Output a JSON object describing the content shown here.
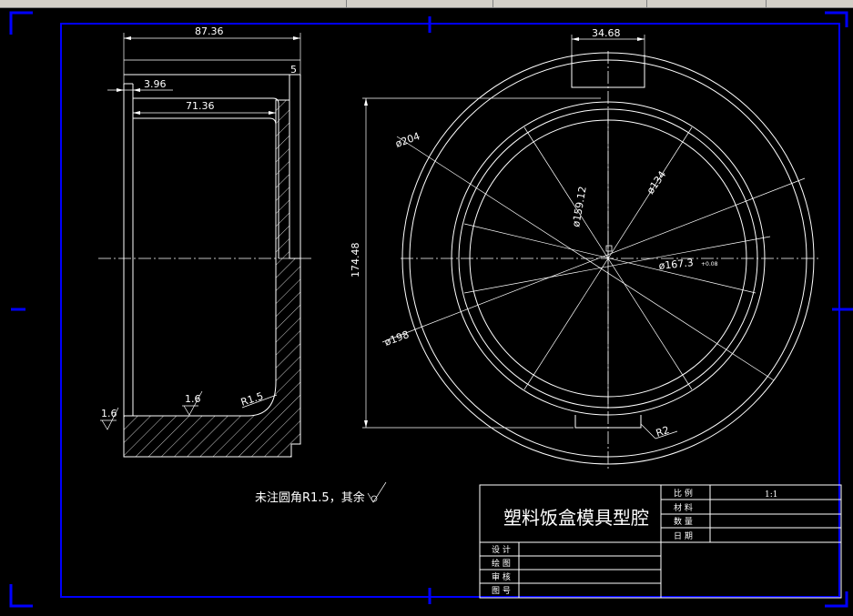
{
  "labels": {
    "dim_width": "87.36",
    "dim_inner": "71.36",
    "dim_wall": "3.96",
    "dim_flange": "5",
    "dim_slot": "34.68",
    "dim_height": "174.48",
    "dia_204": "ø204",
    "dia_198": "ø198",
    "dia_134": "ø134",
    "dia_159": "ø159.12",
    "dia_167": "ø167.3",
    "dia_167_tol": "+0.08",
    "radius_r2": "R2",
    "radius_r15": "R1.5",
    "rough_a": "1.6",
    "rough_b": "1.6",
    "note": "未注圆角R1.5，其余"
  },
  "title_block": {
    "title": "塑料饭盒模具型腔",
    "props": [
      {
        "label": "比 例",
        "value": "1:1"
      },
      {
        "label": "材 料",
        "value": ""
      },
      {
        "label": "数 量",
        "value": ""
      },
      {
        "label": "日 期",
        "value": ""
      }
    ],
    "roles": [
      "设 计",
      "绘 图",
      "审 核",
      "图 号"
    ]
  },
  "colors": {
    "background": "#000000",
    "linework": "#ffffff",
    "frame": "#0000ff"
  }
}
